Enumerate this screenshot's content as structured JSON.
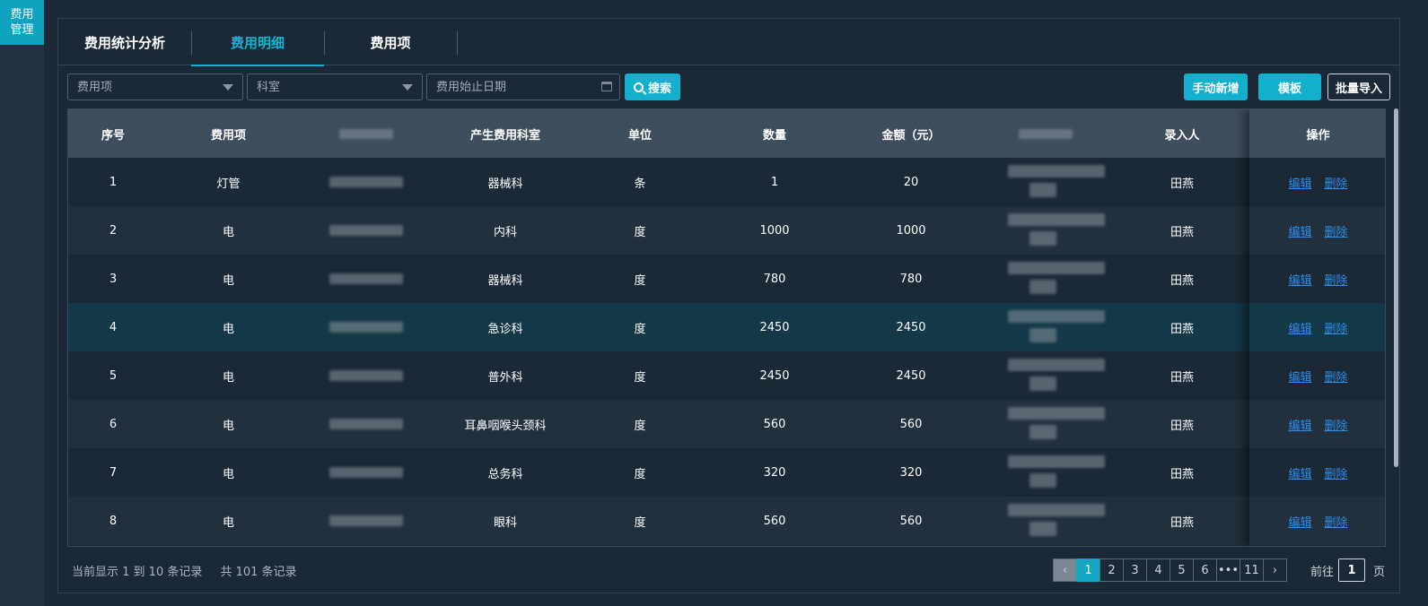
{
  "sidebar": {
    "item_label": "费用\n管理"
  },
  "tabs": [
    {
      "label": "费用统计分析"
    },
    {
      "label": "费用明细"
    },
    {
      "label": "费用项"
    }
  ],
  "filters": {
    "fee_item_placeholder": "费用项",
    "department_placeholder": "科室",
    "date_placeholder": "费用始止日期",
    "search_label": "搜索"
  },
  "actions": {
    "add_label": "手动新增",
    "template_label": "模板",
    "import_label": "批量导入"
  },
  "table": {
    "columns": [
      "序号",
      "费用项",
      "",
      "产生费用科室",
      "单位",
      "数量",
      "金额（元）",
      "",
      "录入人",
      "操作"
    ],
    "rows": [
      {
        "no": "1",
        "item": "灯管",
        "dept": "器械科",
        "unit": "条",
        "qty": "1",
        "amount": "20",
        "entry": "田燕"
      },
      {
        "no": "2",
        "item": "电",
        "dept": "内科",
        "unit": "度",
        "qty": "1000",
        "amount": "1000",
        "entry": "田燕"
      },
      {
        "no": "3",
        "item": "电",
        "dept": "器械科",
        "unit": "度",
        "qty": "780",
        "amount": "780",
        "entry": "田燕"
      },
      {
        "no": "4",
        "item": "电",
        "dept": "急诊科",
        "unit": "度",
        "qty": "2450",
        "amount": "2450",
        "entry": "田燕"
      },
      {
        "no": "5",
        "item": "电",
        "dept": "普外科",
        "unit": "度",
        "qty": "2450",
        "amount": "2450",
        "entry": "田燕"
      },
      {
        "no": "6",
        "item": "电",
        "dept": "耳鼻咽喉头颈科",
        "unit": "度",
        "qty": "560",
        "amount": "560",
        "entry": "田燕"
      },
      {
        "no": "7",
        "item": "电",
        "dept": "总务科",
        "unit": "度",
        "qty": "320",
        "amount": "320",
        "entry": "田燕"
      },
      {
        "no": "8",
        "item": "电",
        "dept": "眼科",
        "unit": "度",
        "qty": "560",
        "amount": "560",
        "entry": "田燕"
      }
    ],
    "edit_label": "编辑",
    "delete_label": "删除"
  },
  "footer": {
    "range_text": "当前显示 1 到 10 条记录",
    "total_text": "共 101 条记录",
    "pages": [
      "1",
      "2",
      "3",
      "4",
      "5",
      "6",
      "•••",
      "11"
    ],
    "goto_label": "前往",
    "goto_value": "1",
    "page_suffix": "页"
  },
  "colors": {
    "accent": "#13b5d1",
    "link": "#2e8ee8",
    "background": "#1c2937"
  }
}
